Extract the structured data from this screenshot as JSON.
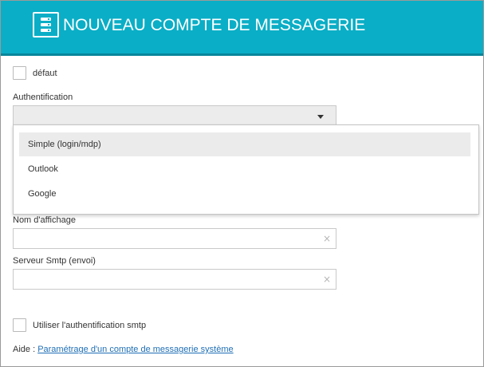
{
  "header": {
    "icon": "server-icon",
    "title": "NOUVEAU COMPTE DE MESSAGERIE",
    "color": "#0aaec6"
  },
  "form": {
    "default_label": "défaut",
    "auth_label": "Authentification",
    "auth_selected": "",
    "auth_options": [
      "Simple (login/mdp)",
      "Outlook",
      "Google"
    ],
    "display_name_label": "Nom d'affichage",
    "display_name_value": "",
    "smtp_label": "Serveur Smtp (envoi)",
    "smtp_value": "",
    "clear_icon": "×",
    "smtp_auth_label": "Utiliser l'authentification smtp"
  },
  "help": {
    "prefix": "Aide : ",
    "link_text": "Paramétrage d'un compte de messagerie système"
  }
}
